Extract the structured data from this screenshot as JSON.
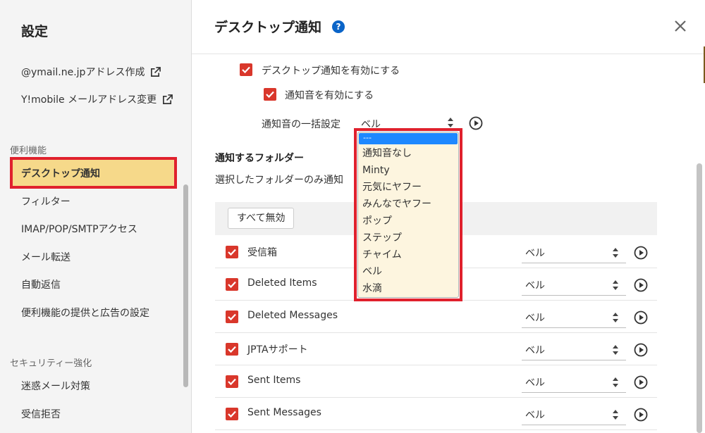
{
  "sidebar": {
    "title": "設定",
    "links": [
      {
        "label": "@ymail.ne.jpアドレス作成"
      },
      {
        "label": "Y!mobile メールアドレス変更"
      }
    ],
    "sections": [
      {
        "label": "便利機能"
      },
      {
        "label": "セキュリティー強化"
      }
    ],
    "items": [
      {
        "label": "デスクトップ通知",
        "active": true
      },
      {
        "label": "フィルター"
      },
      {
        "label": "IMAP/POP/SMTPアクセス"
      },
      {
        "label": "メール転送"
      },
      {
        "label": "自動返信"
      },
      {
        "label": "便利機能の提供と広告の設定"
      },
      {
        "label": "迷惑メール対策"
      },
      {
        "label": "受信拒否"
      }
    ]
  },
  "dialog": {
    "title": "デスクトップ通知",
    "help_glyph": "?",
    "enable_desktop_label": "デスクトップ通知を有効にする",
    "enable_sound_label": "通知音を有効にする",
    "bulk_sound_label": "通知音の一括設定",
    "bulk_sound_value": "ベル",
    "folders_heading": "通知するフォルダー",
    "folders_desc": "選択したフォルダーのみ通知",
    "disable_all_button": "すべて無効"
  },
  "dropdown": {
    "options": [
      "---",
      "通知音なし",
      "Minty",
      "元気にヤフー",
      "みんなでヤフー",
      "ポップ",
      "ステップ",
      "チャイム",
      "ベル",
      "水滴"
    ],
    "highlighted": "---"
  },
  "folders": [
    {
      "name": "受信箱",
      "sound": "ベル",
      "checked": true
    },
    {
      "name": "Deleted Items",
      "sound": "ベル",
      "checked": true
    },
    {
      "name": "Deleted Messages",
      "sound": "ベル",
      "checked": true
    },
    {
      "name": "JPTAサポート",
      "sound": "ベル",
      "checked": true
    },
    {
      "name": "Sent Items",
      "sound": "ベル",
      "checked": true
    },
    {
      "name": "Sent Messages",
      "sound": "ベル",
      "checked": true
    }
  ],
  "colors": {
    "accent_red": "#e0212d",
    "checkbox": "#d9372b",
    "active_item_bg": "#f6d98a",
    "help_blue": "#0a64c8",
    "dropdown_bg": "#fdf5df",
    "highlight_blue": "#1e88ff"
  }
}
